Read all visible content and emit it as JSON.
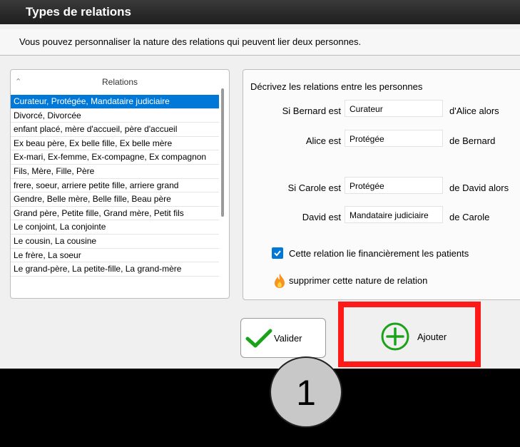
{
  "window": {
    "title": "Types de relations"
  },
  "description": "Vous pouvez personnaliser la nature des relations qui peuvent lier deux personnes.",
  "relations": {
    "header": "Relations",
    "items": [
      "Curateur, Protégée, Mandataire judiciaire",
      "Divorcé, Divorcée",
      "enfant placé, mère d'accueil, père d'accueil",
      "Ex beau père, Ex belle fille, Ex belle mère",
      "Ex-mari, Ex-femme, Ex-compagne, Ex compagnon",
      "Fils, Mère, Fille, Père",
      "frere, soeur, arriere petite fille, arriere grand",
      "Gendre, Belle mère, Belle fille, Beau père",
      "Grand père, Petite fille, Grand mère, Petit fils",
      "Le conjoint, La conjointe",
      "Le cousin, La cousine",
      "Le frère, La soeur",
      "Le grand-père, La petite-fille, La grand-mère"
    ],
    "selected_index": 0
  },
  "panel": {
    "heading": "Décrivez les relations entre les personnes",
    "line1": {
      "prefix": "Si Bernard est",
      "value": "Curateur",
      "suffix": "d'Alice alors"
    },
    "line2": {
      "prefix": "Alice est",
      "value": "Protégée",
      "suffix": "de Bernard"
    },
    "line3": {
      "prefix": "Si Carole est",
      "value": "Protégée",
      "suffix": "de David alors"
    },
    "line4": {
      "prefix": "David est",
      "value": "Mandataire judiciaire",
      "suffix": "de Carole"
    },
    "checkbox": {
      "label": "Cette relation lie financièrement les patients",
      "checked": true
    },
    "delete_label": "supprimer cette nature de relation"
  },
  "buttons": {
    "validate": "Valider",
    "add": "Ajouter"
  },
  "annotation": {
    "step": "1"
  },
  "colors": {
    "selection": "#0078d7",
    "highlight": "#ff1a1a",
    "check": "#1aa31a",
    "add": "#1aa31a"
  }
}
